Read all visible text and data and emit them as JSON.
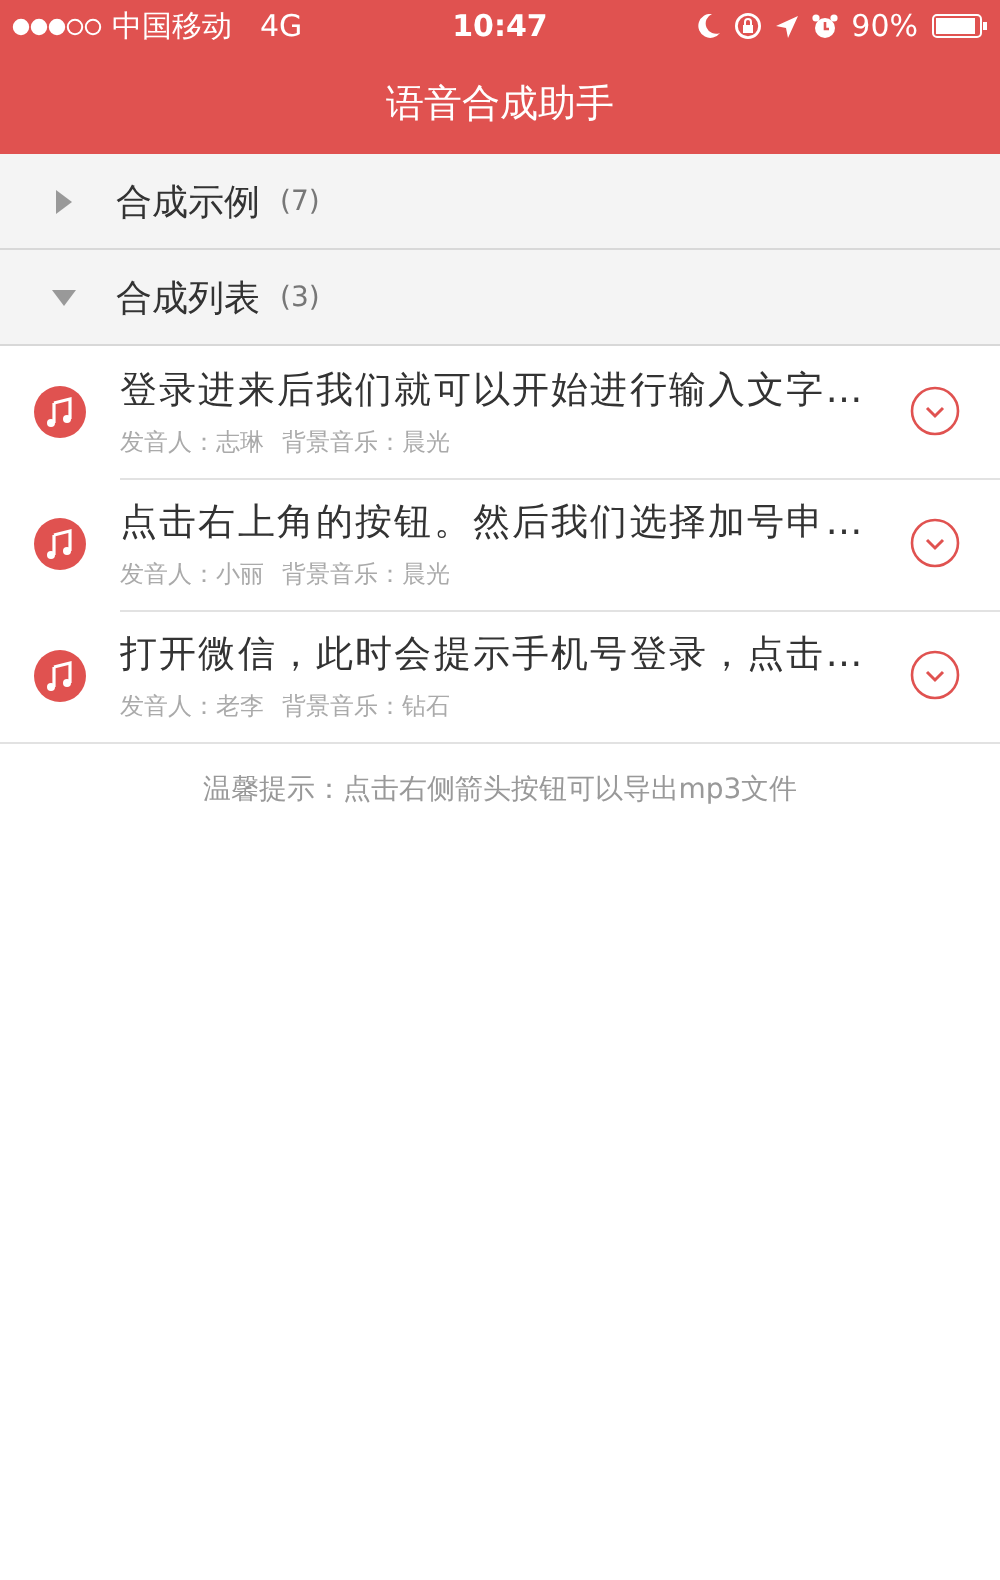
{
  "status_bar": {
    "carrier": "中国移动",
    "network": "4G",
    "time": "10:47",
    "battery": "90%"
  },
  "nav": {
    "title": "语音合成助手"
  },
  "sections": [
    {
      "title": "合成示例",
      "count": "(7)",
      "expanded": false
    },
    {
      "title": "合成列表",
      "count": "(3)",
      "expanded": true,
      "items": [
        {
          "text": "登录进来后我们就可以开始进行输入文字…",
          "speaker": "发音人：志琳",
          "music": "背景音乐：晨光"
        },
        {
          "text": "点击右上角的按钮。然后我们选择加号申…",
          "speaker": "发音人：小丽",
          "music": "背景音乐：晨光"
        },
        {
          "text": "打开微信，此时会提示手机号登录，点击…",
          "speaker": "发音人：老李",
          "music": "背景音乐：钻石"
        }
      ]
    }
  ],
  "hint": "温馨提示：点击右侧箭头按钮可以导出mp3文件"
}
